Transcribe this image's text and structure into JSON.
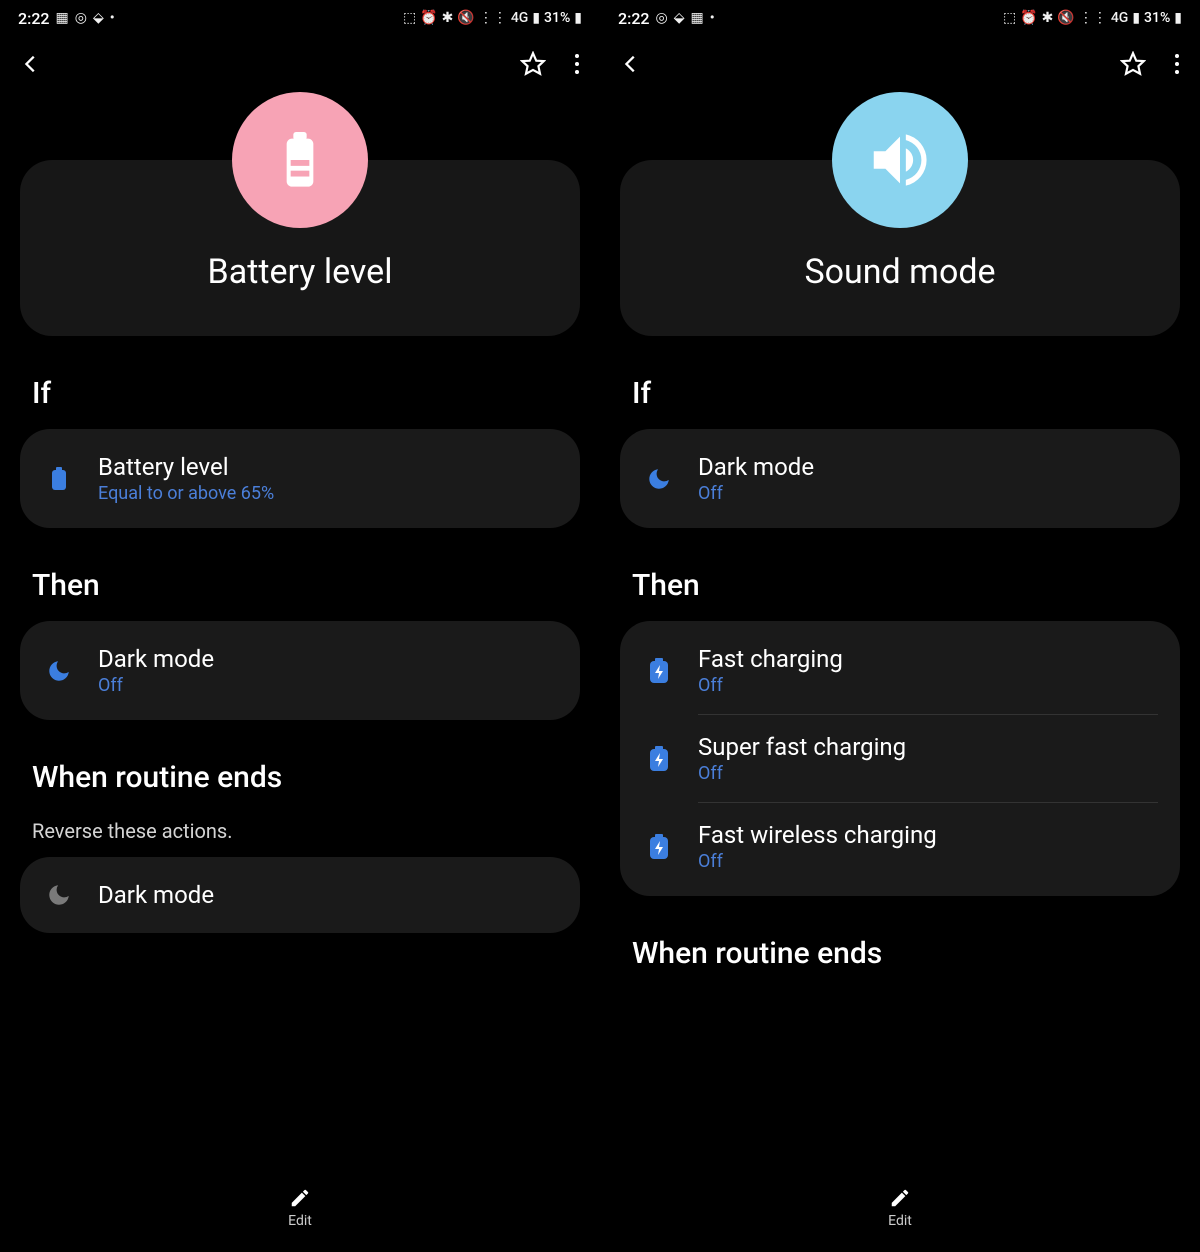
{
  "status": {
    "time": "2:22",
    "battery_pct": "31%"
  },
  "screens": [
    {
      "hero_title": "Battery level",
      "hero_color": "pink",
      "if_label": "If",
      "if_items": [
        {
          "icon": "battery",
          "title": "Battery level",
          "sub": "Equal to or above 65%"
        }
      ],
      "then_label": "Then",
      "then_items": [
        {
          "icon": "moon",
          "title": "Dark mode",
          "sub": "Off"
        }
      ],
      "end_label": "When routine ends",
      "end_sub": "Reverse these actions.",
      "end_items": [
        {
          "icon": "moon-grey",
          "title": "Dark mode"
        }
      ],
      "edit_label": "Edit"
    },
    {
      "hero_title": "Sound mode",
      "hero_color": "blue",
      "if_label": "If",
      "if_items": [
        {
          "icon": "moon",
          "title": "Dark mode",
          "sub": "Off"
        }
      ],
      "then_label": "Then",
      "then_items": [
        {
          "icon": "bolt",
          "title": "Fast charging",
          "sub": "Off"
        },
        {
          "icon": "bolt",
          "title": "Super fast charging",
          "sub": "Off"
        },
        {
          "icon": "bolt",
          "title": "Fast wireless charging",
          "sub": "Off"
        }
      ],
      "end_label": "When routine ends",
      "edit_label": "Edit"
    }
  ]
}
